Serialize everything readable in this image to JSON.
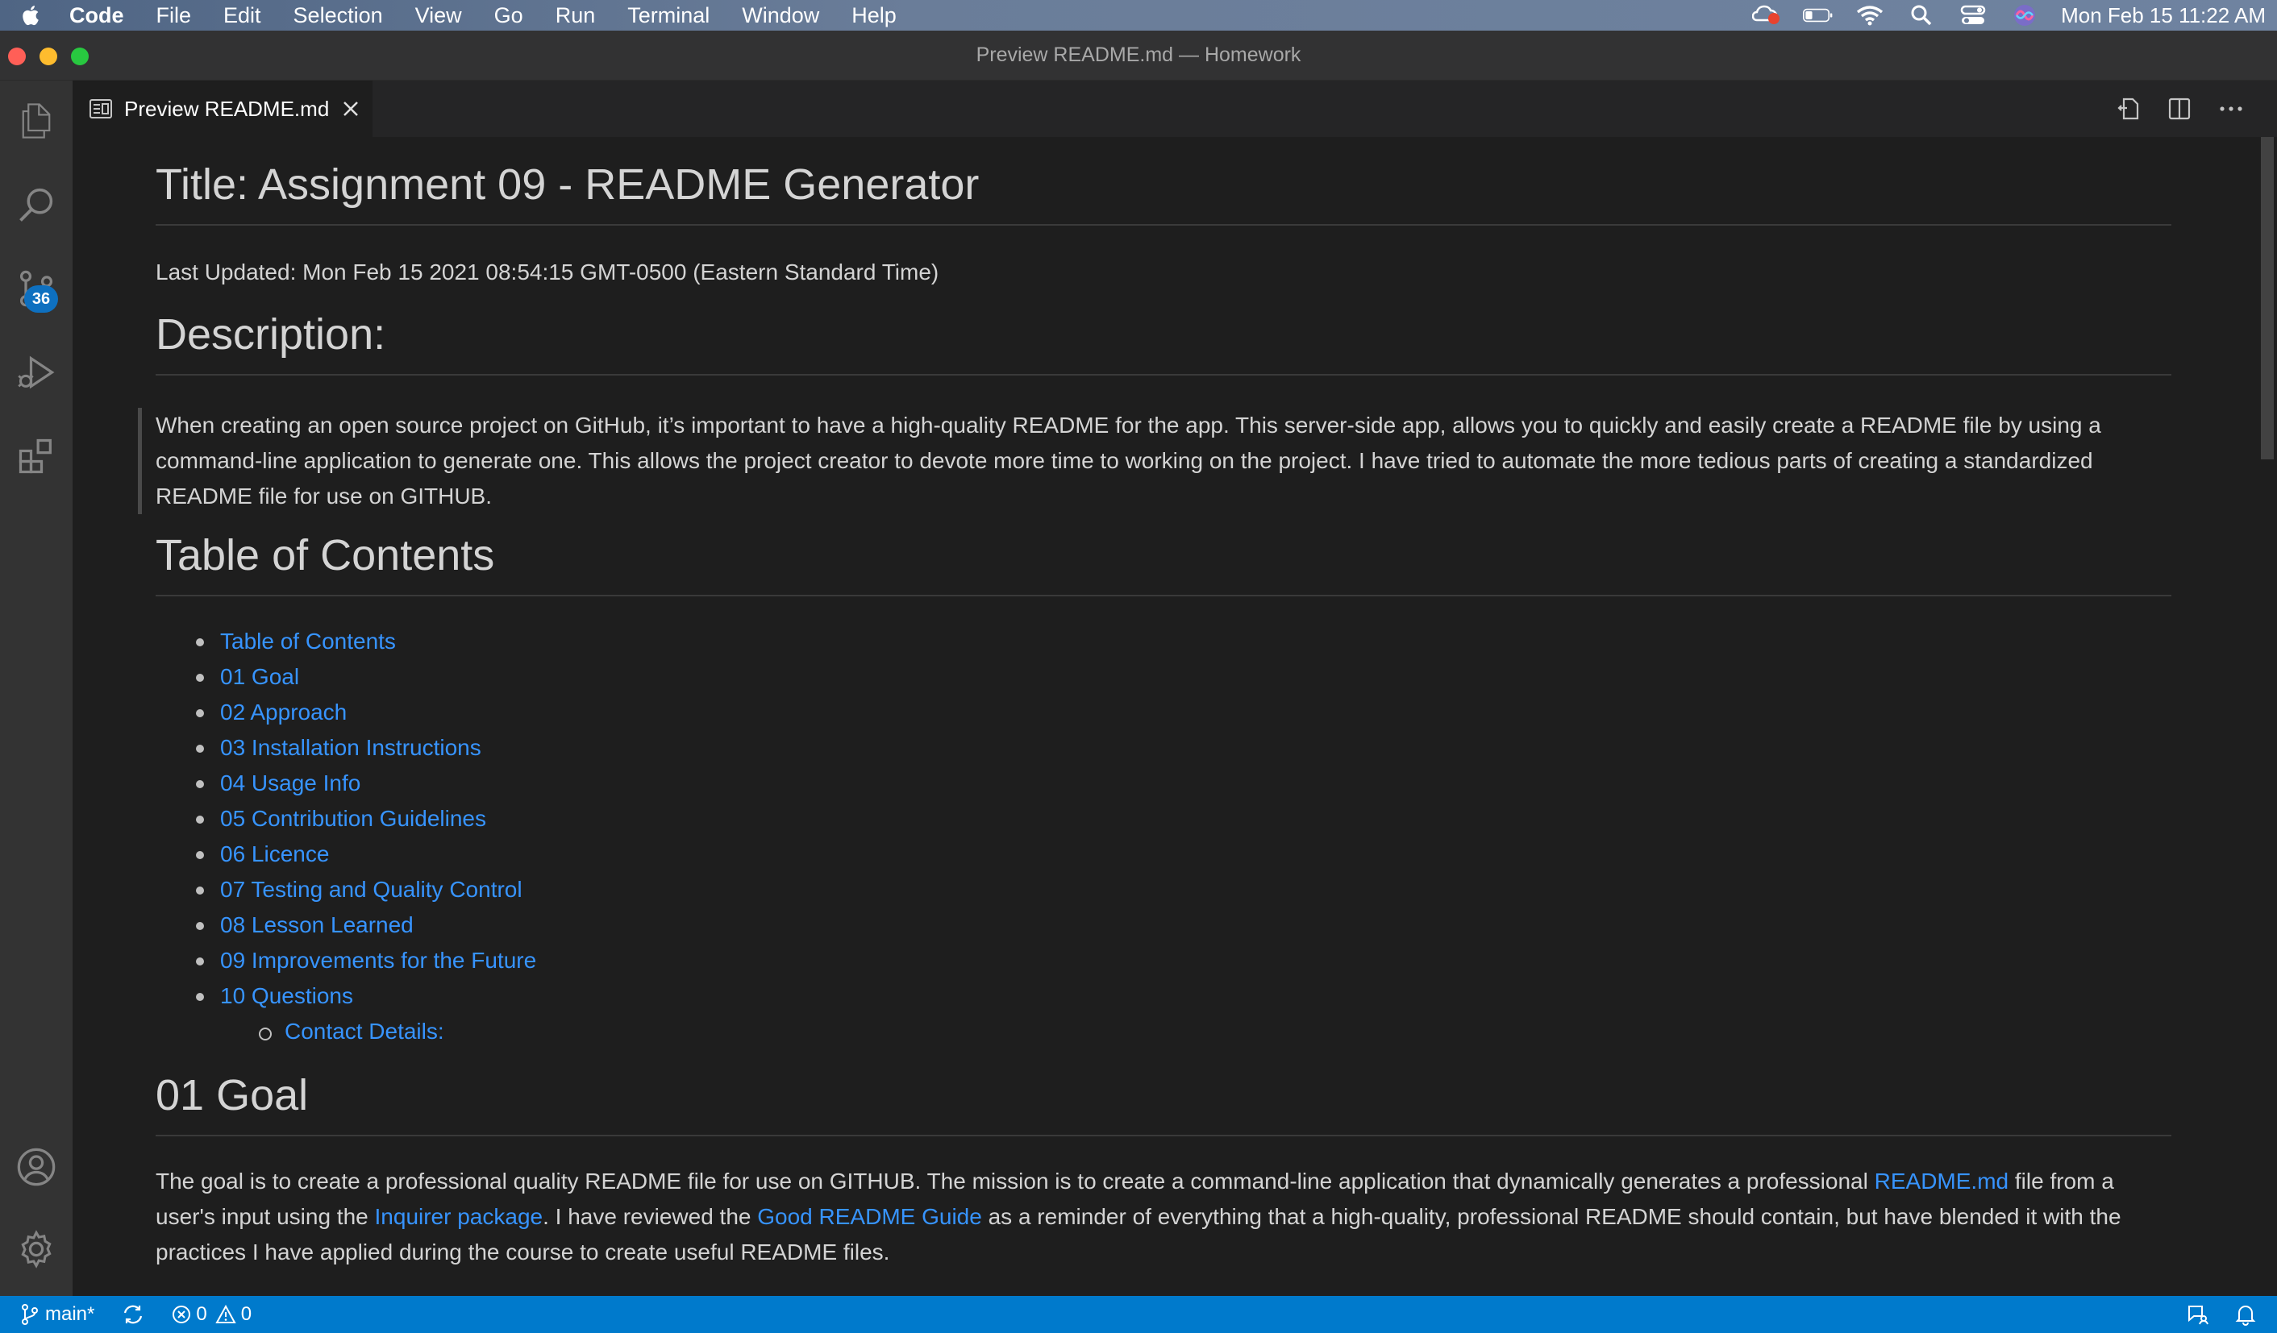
{
  "menubar": {
    "apple_icon": "apple-logo-icon",
    "items": [
      "Code",
      "File",
      "Edit",
      "Selection",
      "View",
      "Go",
      "Run",
      "Terminal",
      "Window",
      "Help"
    ],
    "tray_icons": [
      "creative-cloud-icon",
      "battery-icon",
      "wifi-icon",
      "spotlight-search-icon",
      "control-center-icon",
      "siri-icon"
    ],
    "clock": "Mon Feb 15  11:22 AM"
  },
  "window": {
    "title": "Preview README.md — Homework"
  },
  "activitybar": {
    "items": [
      "explorer-icon",
      "search-icon",
      "source-control-icon",
      "run-debug-icon",
      "extensions-icon"
    ],
    "source_control_badge": "36",
    "bottom_items": [
      "account-icon",
      "manage-gear-icon"
    ]
  },
  "tabs": [
    {
      "label": "Preview README.md",
      "icon": "preview-icon",
      "active": true
    }
  ],
  "editor_actions": [
    "open-source-icon",
    "split-editor-icon",
    "more-actions-icon"
  ],
  "preview": {
    "title": "Title: Assignment 09 - README Generator",
    "last_updated": "Last Updated: Mon Feb 15 2021 08:54:15 GMT-0500 (Eastern Standard Time)",
    "description_heading": "Description:",
    "description_text": "When creating an open source project on GitHub, it’s important to have a high-quality README for the app. This server-side app, allows you to quickly and easily create a README file by using a command-line application to generate one. This allows the project creator to devote more time to working on the project. I have tried to automate the more tedious parts of creating a standardized README file for use on GITHUB.",
    "toc_heading": "Table of Contents",
    "toc": [
      "Table of Contents",
      "01 Goal",
      "02 Approach",
      "03 Installation Instructions",
      "04 Usage Info",
      "05 Contribution Guidelines",
      "06 Licence",
      "07 Testing and Quality Control",
      "08 Lesson Learned",
      "09 Improvements for the Future",
      "10 Questions"
    ],
    "toc_sub": "Contact Details:",
    "goal_heading": "01 Goal",
    "goal": {
      "part1": "The goal is to create a professional quality README file for use on GITHUB. The mission is to create a command-line application that dynamically generates a professional ",
      "link1": "README.md",
      "part2": " file from a user's input using the ",
      "link2": "Inquirer package",
      "part3": ". I have reviewed the ",
      "link3": "Good README Guide",
      "part4": " as a reminder of everything that a high-quality, professional README should contain, but have blended it with the practices I have applied during the course to create useful README files."
    }
  },
  "statusbar": {
    "branch": "main*",
    "errors": "0",
    "warnings": "0",
    "right_icons": [
      "feedback-icon",
      "notifications-bell-icon"
    ]
  },
  "colors": {
    "accent": "#007acc",
    "link": "#3794ff",
    "editor_bg": "#1e1e1e",
    "activitybar_bg": "#333333"
  }
}
